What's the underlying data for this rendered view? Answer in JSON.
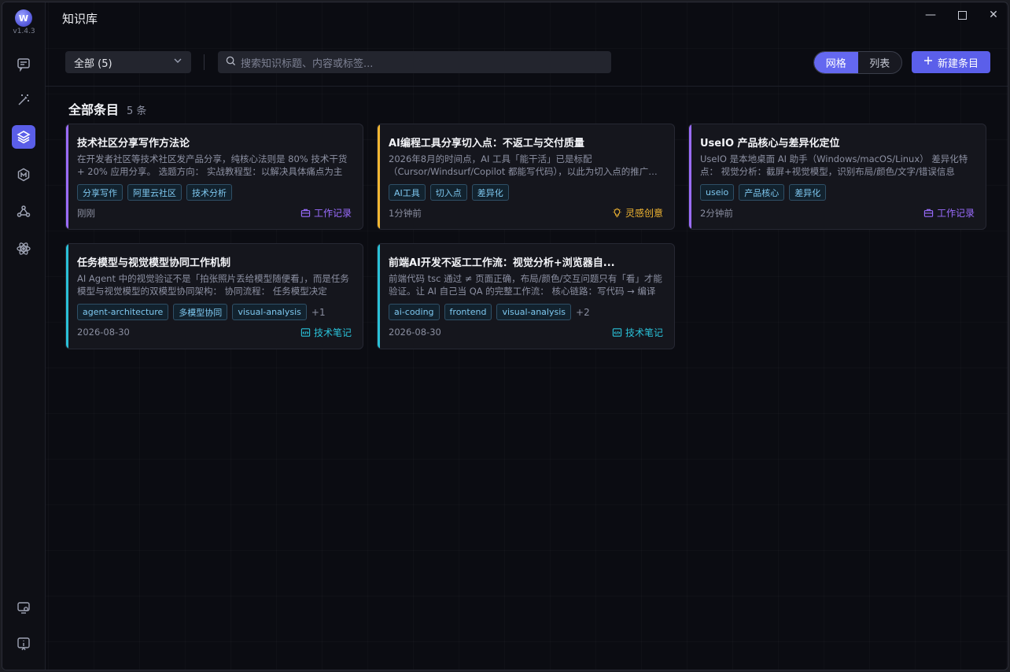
{
  "app": {
    "version": "v1.4.3",
    "title": "知识库"
  },
  "toolbar": {
    "filter_label": "全部 (5)",
    "search_placeholder": "搜索知识标题、内容或标签...",
    "view_grid": "网格",
    "view_list": "列表",
    "new_label": "新建条目"
  },
  "section": {
    "title": "全部条目",
    "count": "5 条"
  },
  "colors": {
    "accent": "#5b5fea",
    "work": "#9b6cff",
    "idea": "#f2b632",
    "tech": "#2ac1d8"
  },
  "cards": [
    {
      "title": "技术社区分享写作方法论",
      "desc": "在开发者社区等技术社区发产品分享，纯核心法则是 80% 技术干货 + 20% 应用分享。 选题方向： 实战教程型：以解决具体痛点为主",
      "tags": [
        "分享写作",
        "阿里云社区",
        "技术分析"
      ],
      "more": "",
      "time": "刚刚",
      "category": "工作记录",
      "category_icon": "briefcase-icon",
      "category_color": "#9b6cff"
    },
    {
      "title": "AI编程工具分享切入点：不返工与交付质量",
      "desc": "2026年8月的时间点，AI 工具「能干活」已是标配（Cursor/Windsurf/Copilot 都能写代码），以此为切入点的推广已无新意",
      "tags": [
        "AI工具",
        "切入点",
        "差异化"
      ],
      "more": "",
      "time": "1分钟前",
      "category": "灵感创意",
      "category_icon": "lightbulb-icon",
      "category_color": "#f2b632"
    },
    {
      "title": "UseIO 产品核心与差异化定位",
      "desc": "UseIO 是本地桌面 AI 助手（Windows/macOS/Linux） 差异化特点： 视觉分析：截屏+视觉模型，识别布局/颜色/文字/错误信息",
      "tags": [
        "useio",
        "产品核心",
        "差异化"
      ],
      "more": "",
      "time": "2分钟前",
      "category": "工作记录",
      "category_icon": "briefcase-icon",
      "category_color": "#9b6cff"
    },
    {
      "title": "任务模型与视觉模型协同工作机制",
      "desc": "AI Agent 中的视觉验证不是「拍张照片丢给模型随便看」，而是任务模型与视觉模型的双模型协同架构： 协同流程： 任务模型决定",
      "tags": [
        "agent-architecture",
        "多模型协同",
        "visual-analysis"
      ],
      "more": "+1",
      "time": "2026-08-30",
      "category": "技术笔记",
      "category_icon": "code-icon",
      "category_color": "#2ac1d8"
    },
    {
      "title": "前端AI开发不返工工作流：视觉分析+浏览器自...",
      "desc": "前端代码 tsc 通过 ≠ 页面正确，布局/颜色/交互问题只有「看」才能验证。让 AI 自己当 QA 的完整工作流： 核心链路：写代码 → 编译",
      "tags": [
        "ai-coding",
        "frontend",
        "visual-analysis"
      ],
      "more": "+2",
      "time": "2026-08-30",
      "category": "技术笔记",
      "category_icon": "code-icon",
      "category_color": "#2ac1d8"
    }
  ]
}
